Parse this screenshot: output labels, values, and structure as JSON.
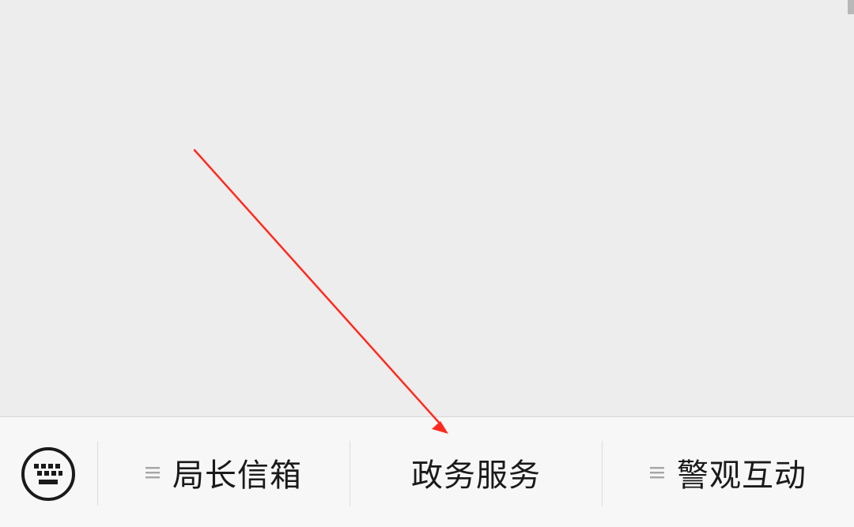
{
  "menu": {
    "keyboard_icon": "keyboard-icon",
    "items": [
      {
        "label": "局长信箱",
        "icon": "menu-lines-icon",
        "has_submenu": true
      },
      {
        "label": "政务服务",
        "icon": "",
        "has_submenu": false
      },
      {
        "label": "警观互动",
        "icon": "menu-lines-icon",
        "has_submenu": true
      }
    ]
  },
  "colors": {
    "background": "#ededed",
    "menu_bar": "#f7f7f7",
    "annotation_arrow": "#ff2a1f"
  }
}
